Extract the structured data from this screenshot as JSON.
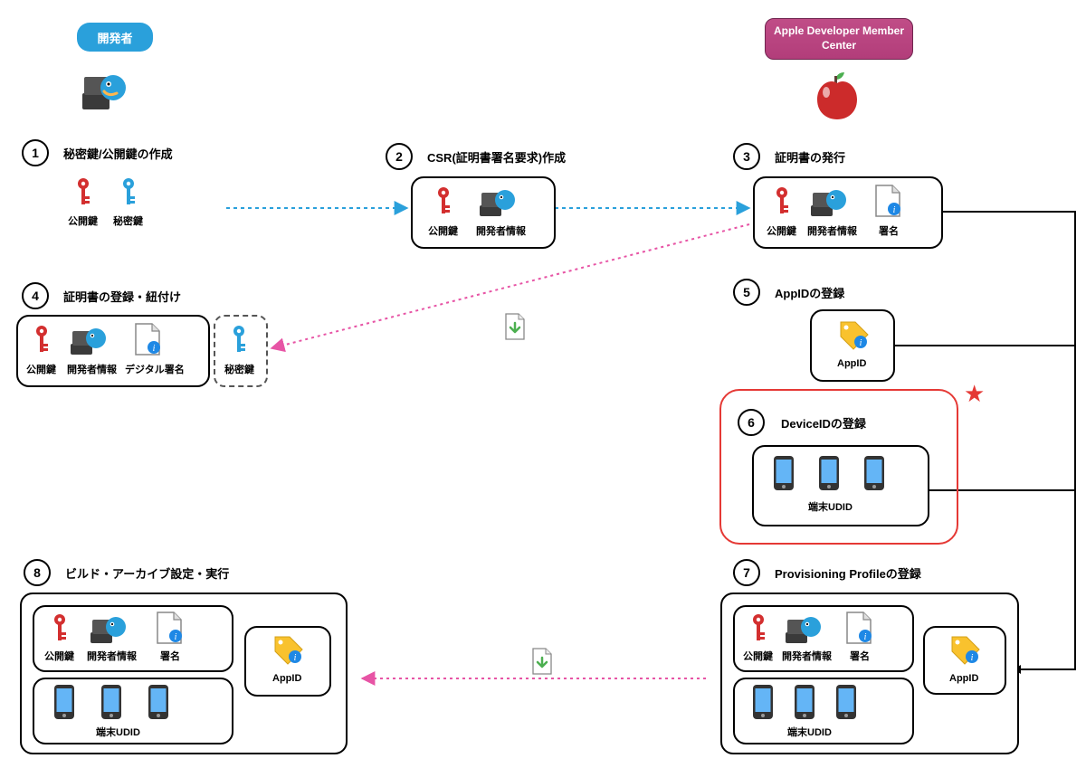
{
  "actors": {
    "developer": "開発者",
    "adc": "Apple Developer Member Center"
  },
  "steps": {
    "s1": {
      "num": "1",
      "title": "秘密鍵/公開鍵の作成"
    },
    "s2": {
      "num": "2",
      "title": "CSR(証明書署名要求)作成"
    },
    "s3": {
      "num": "3",
      "title": "証明書の発行"
    },
    "s4": {
      "num": "4",
      "title": "証明書の登録・紐付け"
    },
    "s5": {
      "num": "5",
      "title": "AppIDの登録"
    },
    "s6": {
      "num": "6",
      "title": "DeviceIDの登録"
    },
    "s7": {
      "num": "7",
      "title": "Provisioning Profileの登録"
    },
    "s8": {
      "num": "8",
      "title": "ビルド・アーカイブ設定・実行"
    }
  },
  "labels": {
    "pubkey": "公開鍵",
    "privkey": "秘密鍵",
    "devinfo": "開発者情報",
    "sign": "署名",
    "digisign": "デジタル署名",
    "appid": "AppID",
    "udid": "端末UDID"
  },
  "colors": {
    "blue": "#2aa0db",
    "pink": "#e754a5",
    "red": "#e53935"
  }
}
